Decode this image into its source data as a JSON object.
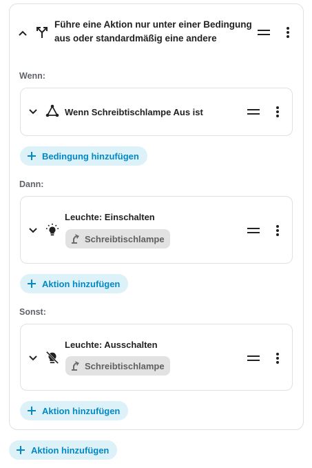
{
  "block": {
    "title": "Führe eine Aktion nur unter einer Bedingung aus oder standardmäßig eine andere",
    "icon": "choose-arrows-icon"
  },
  "sections": {
    "if_label": "Wenn:",
    "then_label": "Dann:",
    "else_label": "Sonst:"
  },
  "condition": {
    "title": "Wenn Schreibtischlampe Aus ist",
    "icon": "state-graph-icon"
  },
  "then_action": {
    "title": "Leuchte: Einschalten",
    "icon": "bulb-on-icon",
    "target": "Schreibtischlampe",
    "target_icon": "desk-lamp-icon"
  },
  "else_action": {
    "title": "Leuchte: Ausschalten",
    "icon": "bulb-off-icon",
    "target": "Schreibtischlampe",
    "target_icon": "desk-lamp-icon"
  },
  "buttons": {
    "add_condition": "Bedingung hinzufügen",
    "add_action_then": "Aktion hinzufügen",
    "add_action_else": "Aktion hinzufügen",
    "add_action_root": "Aktion hinzufügen"
  },
  "colors": {
    "accent": "#0288c4",
    "accent_bg": "#ddf1f8",
    "chip_bg": "#e2e2e2"
  }
}
